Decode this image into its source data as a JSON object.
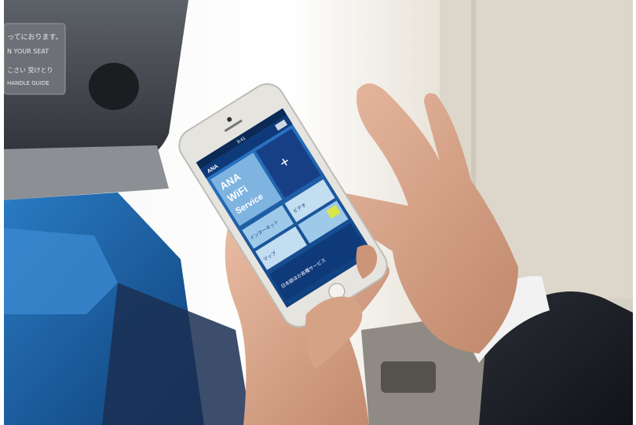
{
  "photo": {
    "subject": "hands holding a smartphone in an airplane cabin seat"
  },
  "seat_placard": {
    "line1": "ってにおります。",
    "line2": "N YOUR SEAT",
    "line3": "こさい 受けとり",
    "line4": "HANDLE GUIDE"
  },
  "phone_screen": {
    "status_time": "9:41",
    "app_brand": "ANA",
    "hero_line1": "ANA",
    "hero_line2": "WiFi",
    "hero_line3": "Service",
    "tile_internet": "インターネット",
    "tile_video": "ビデオ",
    "tile_map": "マップ",
    "banner_text": "日本語ほか各種サービス",
    "nav_icon": "menu-icon",
    "plus_icon": "plus-icon"
  },
  "colors": {
    "screen_blue": "#1f5fa8",
    "screen_dark": "#0f3a7a",
    "tile_light": "#9ec9e8",
    "phone_body": "#e6e4df",
    "cabin_wall": "#e9e6de",
    "seat_blue": "#1d64a7",
    "suit": "#1a1d24",
    "skin": "#d9a387"
  }
}
